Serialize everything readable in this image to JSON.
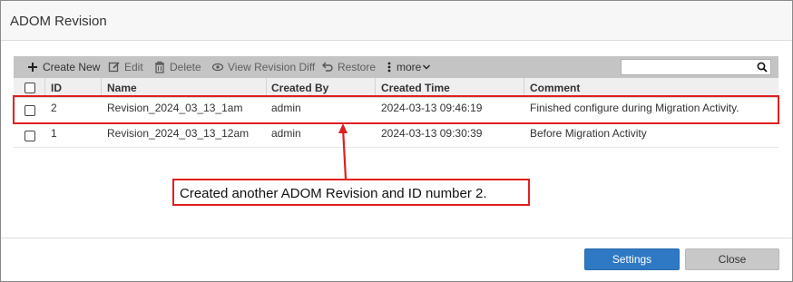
{
  "dialog": {
    "title": "ADOM Revision"
  },
  "toolbar": {
    "create_new": "Create New",
    "edit": "Edit",
    "delete": "Delete",
    "view_revision_diff": "View Revision Diff",
    "restore": "Restore",
    "more": "more",
    "search_value": ""
  },
  "table": {
    "headers": [
      "ID",
      "Name",
      "Created By",
      "Created Time",
      "Comment"
    ],
    "rows": [
      {
        "id": "2",
        "name": "Revision_2024_03_13_1am",
        "created_by": "admin",
        "created_time": "2024-03-13 09:46:19",
        "comment": "Finished configure during Migration Activity."
      },
      {
        "id": "1",
        "name": "Revision_2024_03_13_12am",
        "created_by": "admin",
        "created_time": "2024-03-13 09:30:39",
        "comment": "Before Migration Activity"
      }
    ]
  },
  "annotation": {
    "text": "Created another ADOM Revision and ID number 2."
  },
  "footer": {
    "settings": "Settings",
    "close": "Close"
  },
  "colors": {
    "annotation": "#e02020",
    "primary_button": "#2f79c4",
    "toolbar": "#c4c4c4"
  },
  "icons": [
    "plus-icon",
    "edit-icon",
    "trash-icon",
    "eye-icon",
    "undo-icon",
    "kebab-icon",
    "chevron-down-icon",
    "search-icon",
    "checkbox-icon"
  ]
}
